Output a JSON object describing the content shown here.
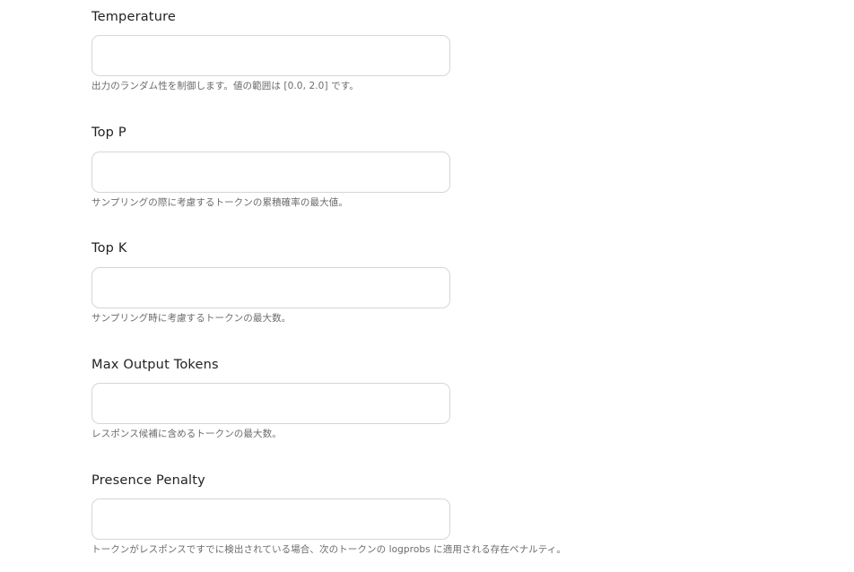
{
  "fields": [
    {
      "label": "Temperature",
      "value": "",
      "placeholder": "",
      "help": "出力のランダム性を制御します。値の範囲は [0.0, 2.0] です。"
    },
    {
      "label": "Top P",
      "value": "",
      "placeholder": "",
      "help": "サンプリングの際に考慮するトークンの累積確率の最大値。"
    },
    {
      "label": "Top K",
      "value": "",
      "placeholder": "",
      "help": "サンプリング時に考慮するトークンの最大数。"
    },
    {
      "label": "Max Output Tokens",
      "value": "",
      "placeholder": "",
      "help": "レスポンス候補に含めるトークンの最大数。"
    },
    {
      "label": "Presence Penalty",
      "value": "",
      "placeholder": "",
      "help": "トークンがレスポンスですでに検出されている場合、次のトークンの logprobs に適用される存在ペナルティ。"
    }
  ]
}
